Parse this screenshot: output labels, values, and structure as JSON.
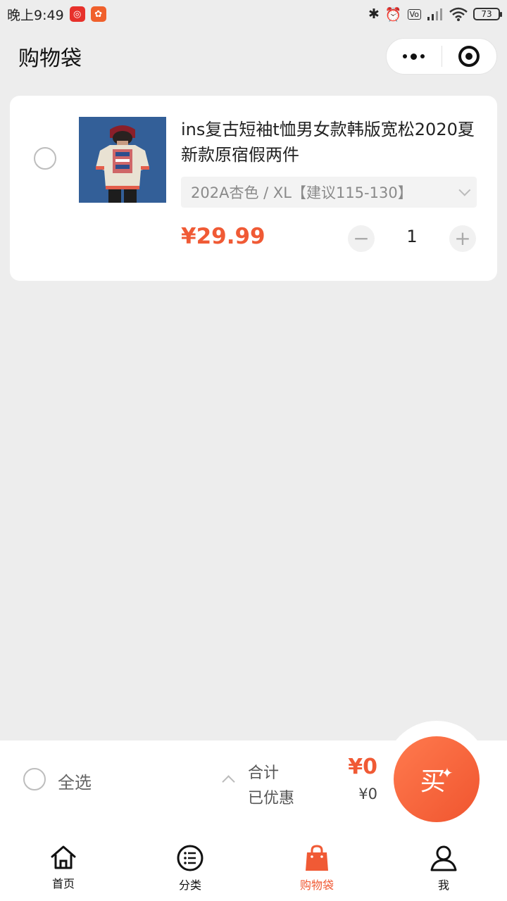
{
  "status_bar": {
    "time": "晚上9:49",
    "battery": "73"
  },
  "header": {
    "title": "购物袋"
  },
  "cart": {
    "items": [
      {
        "title": "ins复古短袖t恤男女款韩版宽松2020夏新款原宿假两件",
        "spec": "202A杏色 / XL【建议115-130】",
        "price": "¥29.99",
        "quantity": "1",
        "minus_label": "−",
        "plus_label": "+"
      }
    ]
  },
  "summary": {
    "select_all_label": "全选",
    "total_label": "合计",
    "total_value": "¥0",
    "discount_label": "已优惠",
    "discount_value": "¥0",
    "buy_label": "买"
  },
  "tabs": [
    {
      "label": "首页",
      "icon": "home-icon"
    },
    {
      "label": "分类",
      "icon": "list-icon"
    },
    {
      "label": "购物袋",
      "icon": "bag-icon",
      "active": true
    },
    {
      "label": "我",
      "icon": "user-icon"
    }
  ],
  "colors": {
    "accent": "#f05a35",
    "background": "#ededed"
  }
}
